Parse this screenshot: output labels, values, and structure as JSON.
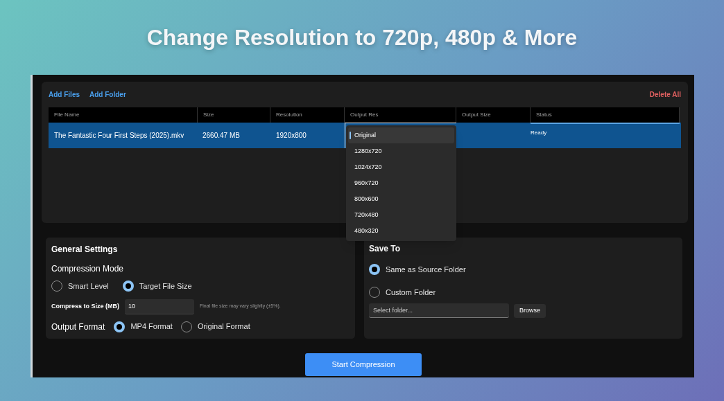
{
  "headline": "Change Resolution to 720p, 480p & More",
  "toolbar": {
    "add_files": "Add Files",
    "add_folder": "Add Folder",
    "delete_all": "Delete All"
  },
  "table": {
    "columns": [
      "File Name",
      "Size",
      "Resolution",
      "Output Res",
      "Output Size",
      "Status"
    ],
    "rows": [
      {
        "file_name": "The Fantastic Four First Steps (2025).mkv",
        "size": "2660.47 MB",
        "resolution": "1920x800",
        "status": "Ready",
        "selected": true
      }
    ]
  },
  "output_res_dropdown": {
    "options": [
      {
        "label": "Original",
        "selected": true
      },
      {
        "label": "1280x720",
        "selected": false
      },
      {
        "label": "1024x720",
        "selected": false
      },
      {
        "label": "960x720",
        "selected": false
      },
      {
        "label": "800x600",
        "selected": false
      },
      {
        "label": "720x480",
        "selected": false
      },
      {
        "label": "480x320",
        "selected": false
      }
    ]
  },
  "general_settings": {
    "title": "General Settings",
    "compression_mode": {
      "label": "Compression Mode",
      "options": [
        {
          "label": "Smart Level",
          "selected": false
        },
        {
          "label": "Target File Size",
          "selected": true
        }
      ]
    },
    "compress_to_size": {
      "label": "Compress to Size (MB)",
      "value": "10",
      "note": "Final file size may vary slightly (±5%)."
    },
    "output_format": {
      "label": "Output Format",
      "options": [
        {
          "label": "MP4 Format",
          "selected": true
        },
        {
          "label": "Original Format",
          "selected": false
        }
      ]
    }
  },
  "save_to": {
    "title": "Save To",
    "options": [
      {
        "label": "Same as Source Folder",
        "selected": true
      },
      {
        "label": "Custom Folder",
        "selected": false
      }
    ],
    "folder_field": {
      "placeholder": "Select folder..."
    },
    "browse": "Browse"
  },
  "start_button": "Start Compression"
}
